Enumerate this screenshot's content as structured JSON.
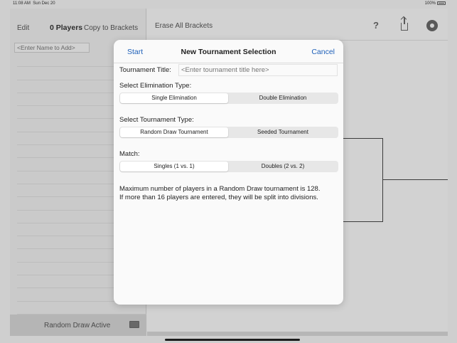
{
  "status_bar": {
    "time": "11:08 AM",
    "date": "Sun Dec 20",
    "battery": "100%"
  },
  "left_panel": {
    "edit_label": "Edit",
    "players_count": "0 Players",
    "copy_label": "Copy to Brackets",
    "name_placeholder": "<Enter Name to Add>",
    "footer_status": "Random Draw Active"
  },
  "right_panel": {
    "erase_label": "Erase All Brackets",
    "help_label": "?"
  },
  "modal": {
    "start_label": "Start",
    "title": "New Tournament Selection",
    "cancel_label": "Cancel",
    "tournament_title_label": "Tournament Title:",
    "tournament_title_placeholder": "<Enter tournament title here>",
    "elimination_label": "Select Elimination Type:",
    "elimination_options": [
      "Single Elimination",
      "Double Elimination"
    ],
    "elimination_selected": "Single Elimination",
    "tournament_type_label": "Select Tournament Type:",
    "tournament_type_options": [
      "Random Draw Tournament",
      "Seeded Tournament"
    ],
    "tournament_type_selected": "Random Draw Tournament",
    "match_label": "Match:",
    "match_options": [
      "Singles (1 vs. 1)",
      "Doubles (2 vs. 2)"
    ],
    "match_selected": "Singles (1 vs. 1)",
    "info_line1": "Maximum number of players in a Random Draw tournament is 128.",
    "info_line2": "If more than 16 players are entered, they will be split into divisions."
  },
  "icons": [
    "wifi-icon",
    "battery-icon",
    "help-icon",
    "share-icon",
    "gear-icon",
    "keyboard-icon"
  ]
}
